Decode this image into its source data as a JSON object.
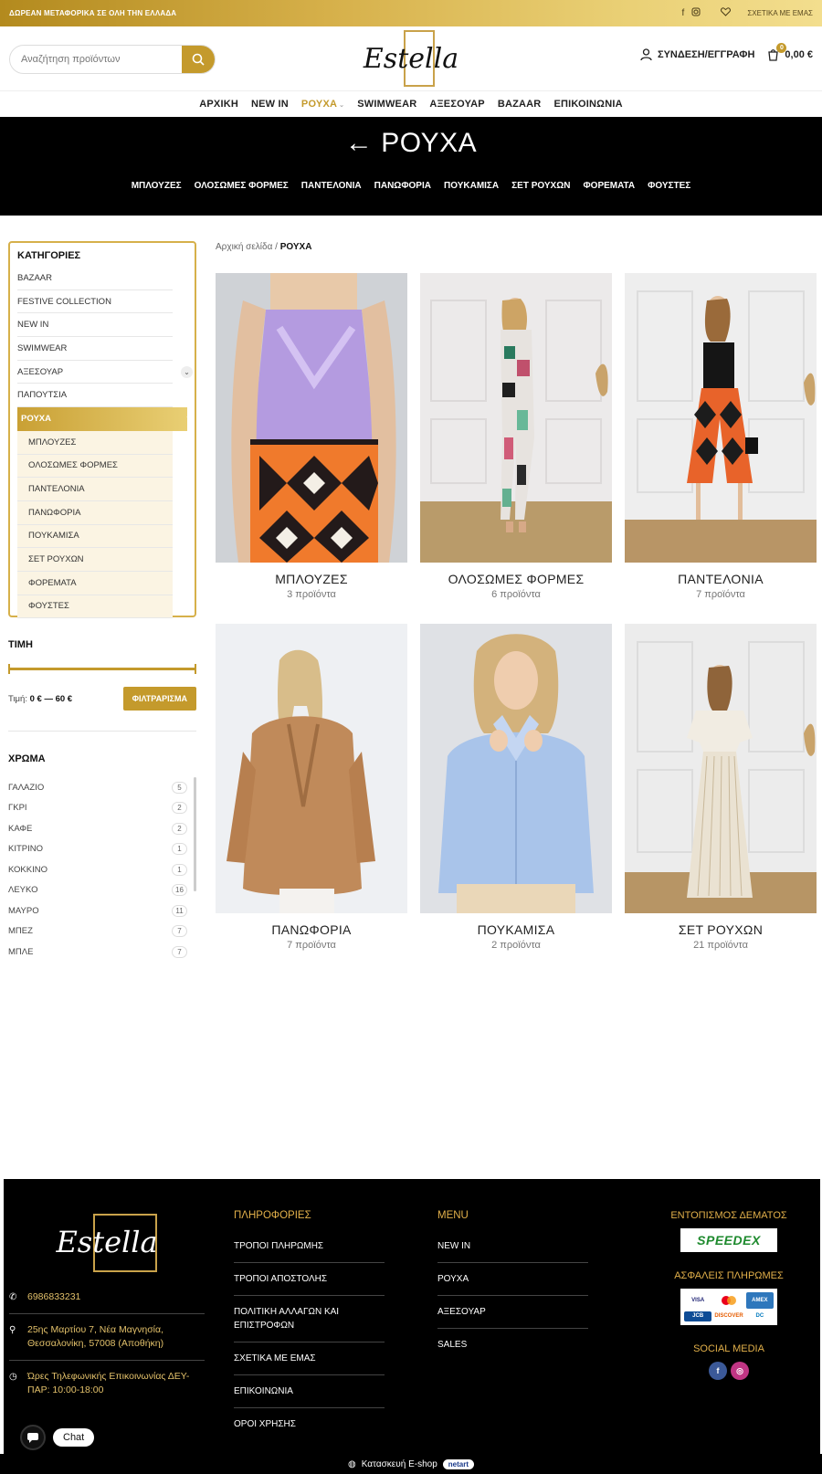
{
  "topbar": {
    "promo": "ΔΩΡΕΑΝ ΜΕΤΑΦΟΡΙΚΑ ΣΕ ΟΛΗ ΤΗΝ ΕΛΛΑΔΑ",
    "about": "ΣΧΕΤΙΚΑ ΜΕ ΕΜΑΣ",
    "icons": [
      "facebook-icon",
      "instagram-icon",
      "heart-icon"
    ]
  },
  "header": {
    "search_placeholder": "Αναζήτηση προϊόντων",
    "logo_text": "Estella",
    "login": "ΣΥΝΔΕΣΗ/ΕΓΓΡΑΦΗ",
    "cart_count": "0",
    "cart_total": "0,00 €"
  },
  "nav": {
    "items": [
      "ΑΡΧΙΚΗ",
      "NEW IN",
      "ΡΟΥΧΑ",
      "SWIMWEAR",
      "ΑΞΕΣΟΥΑΡ",
      "BAZAAR",
      "ΕΠΙΚΟΙΝΩΝΙΑ"
    ],
    "active": "ΡΟΥΧΑ"
  },
  "hero": {
    "title": "← ΡΟΥΧΑ",
    "subcats": [
      "ΜΠΛΟΥΖΕΣ",
      "ΟΛΟΣΩΜΕΣ ΦΟΡΜΕΣ",
      "ΠΑΝΤΕΛΟΝΙΑ",
      "ΠΑΝΩΦΟΡΙΑ",
      "ΠΟΥΚΑΜΙΣΑ",
      "ΣΕΤ ΡΟΥΧΩΝ",
      "ΦΟΡΕΜΑΤΑ",
      "ΦΟΥΣΤΕΣ"
    ]
  },
  "sidebar": {
    "categories_title": "ΚΑΤΗΓΟΡΙΕΣ",
    "categories": [
      "BAZAAR",
      "FESTIVE COLLECTION",
      "NEW IN",
      "SWIMWEAR",
      "ΑΞΕΣΟΥΑΡ",
      "ΠΑΠΟΥΤΣΙΑ",
      "ΡΟΥΧΑ"
    ],
    "active_category": "ΡΟΥΧΑ",
    "subcategories": [
      "ΜΠΛΟΥΖΕΣ",
      "ΟΛΟΣΩΜΕΣ ΦΟΡΜΕΣ",
      "ΠΑΝΤΕΛΟΝΙΑ",
      "ΠΑΝΩΦΟΡΙΑ",
      "ΠΟΥΚΑΜΙΣΑ",
      "ΣΕΤ ΡΟΥΧΩΝ",
      "ΦΟΡΕΜΑΤΑ",
      "ΦΟΥΣΤΕΣ"
    ],
    "price_title": "ΤΙΜΗ",
    "price_label": "Τιμή:",
    "price_range": "0 € — 60 €",
    "filter_button": "ΦΙΛΤΡΑΡΙΣΜΑ",
    "color_title": "ΧΡΩΜΑ",
    "colors": [
      {
        "name": "ΓΑΛΑΖΙΟ",
        "count": "5"
      },
      {
        "name": "ΓΚΡΙ",
        "count": "2"
      },
      {
        "name": "ΚΑΦΕ",
        "count": "2"
      },
      {
        "name": "ΚΙΤΡΙΝΟ",
        "count": "1"
      },
      {
        "name": "ΚΟΚΚΙΝΟ",
        "count": "1"
      },
      {
        "name": "ΛΕΥΚΟ",
        "count": "16"
      },
      {
        "name": "ΜΑΥΡΟ",
        "count": "11"
      },
      {
        "name": "ΜΠΕΖ",
        "count": "7"
      },
      {
        "name": "ΜΠΛΕ",
        "count": "7"
      }
    ]
  },
  "breadcrumb": {
    "home": "Αρχική σελίδα",
    "sep": "/",
    "current": "ΡΟΥΧΑ"
  },
  "products": [
    {
      "name": "ΜΠΛΟΥΖΕΣ",
      "count": "3 προϊόντα"
    },
    {
      "name": "ΟΛΟΣΩΜΕΣ ΦΟΡΜΕΣ",
      "count": "6 προϊόντα"
    },
    {
      "name": "ΠΑΝΤΕΛΟΝΙΑ",
      "count": "7 προϊόντα"
    },
    {
      "name": "ΠΑΝΩΦΟΡΙΑ",
      "count": "7 προϊόντα"
    },
    {
      "name": "ΠΟΥΚΑΜΙΣΑ",
      "count": "2 προϊόντα"
    },
    {
      "name": "ΣΕΤ ΡΟΥΧΩΝ",
      "count": "21 προϊόντα"
    }
  ],
  "footer": {
    "logo_text": "Estella",
    "phone": "6986833231",
    "address": "25ης Μαρτίου 7, Νέα Μαγνησία, Θεσσαλονίκη, 57008 (Αποθήκη)",
    "hours": "Ώρες Τηλεφωνικής Επικοινωνίας ΔΕΥ-ΠΑΡ: 10:00-18:00",
    "info_title": "ΠΛΗΡΟΦΟΡΙΕΣ",
    "info_links": [
      "ΤΡΟΠΟΙ ΠΛΗΡΩΜΗΣ",
      "ΤΡΟΠΟΙ ΑΠΟΣΤΟΛΗΣ",
      "ΠΟΛΙΤΙΚΗ ΑΛΛΑΓΩΝ ΚΑΙ ΕΠΙΣΤΡΟΦΩΝ",
      "ΣΧΕΤΙΚΑ ΜΕ ΕΜΑΣ",
      "ΕΠΙΚΟΙΝΩΝΙΑ",
      "ΟΡΟΙ ΧΡΗΣΗΣ"
    ],
    "menu_title": "MENU",
    "menu_links": [
      "NEW IN",
      "ΡΟΥΧΑ",
      "ΑΞΕΣΟΥΑΡ",
      "SALES"
    ],
    "tracking_title": "ΕΝΤΟΠΙΣΜΟΣ ΔΕΜΑΤΟΣ",
    "courier": "SPEEDEX",
    "payments_title": "ΑΣΦΑΛΕΙΣ ΠΛΗΡΩΜΕΣ",
    "payment_marks": [
      "VISA",
      "MC",
      "AMEX",
      "JCB",
      "DISCOVER",
      "DC"
    ],
    "social_title": "SOCIAL MEDIA"
  },
  "bottom": {
    "credit": "Κατασκευή E-shop",
    "brand": "netart"
  },
  "chat": {
    "label": "Chat"
  },
  "colors": {
    "gold": "#c49a2c",
    "black": "#000000"
  }
}
